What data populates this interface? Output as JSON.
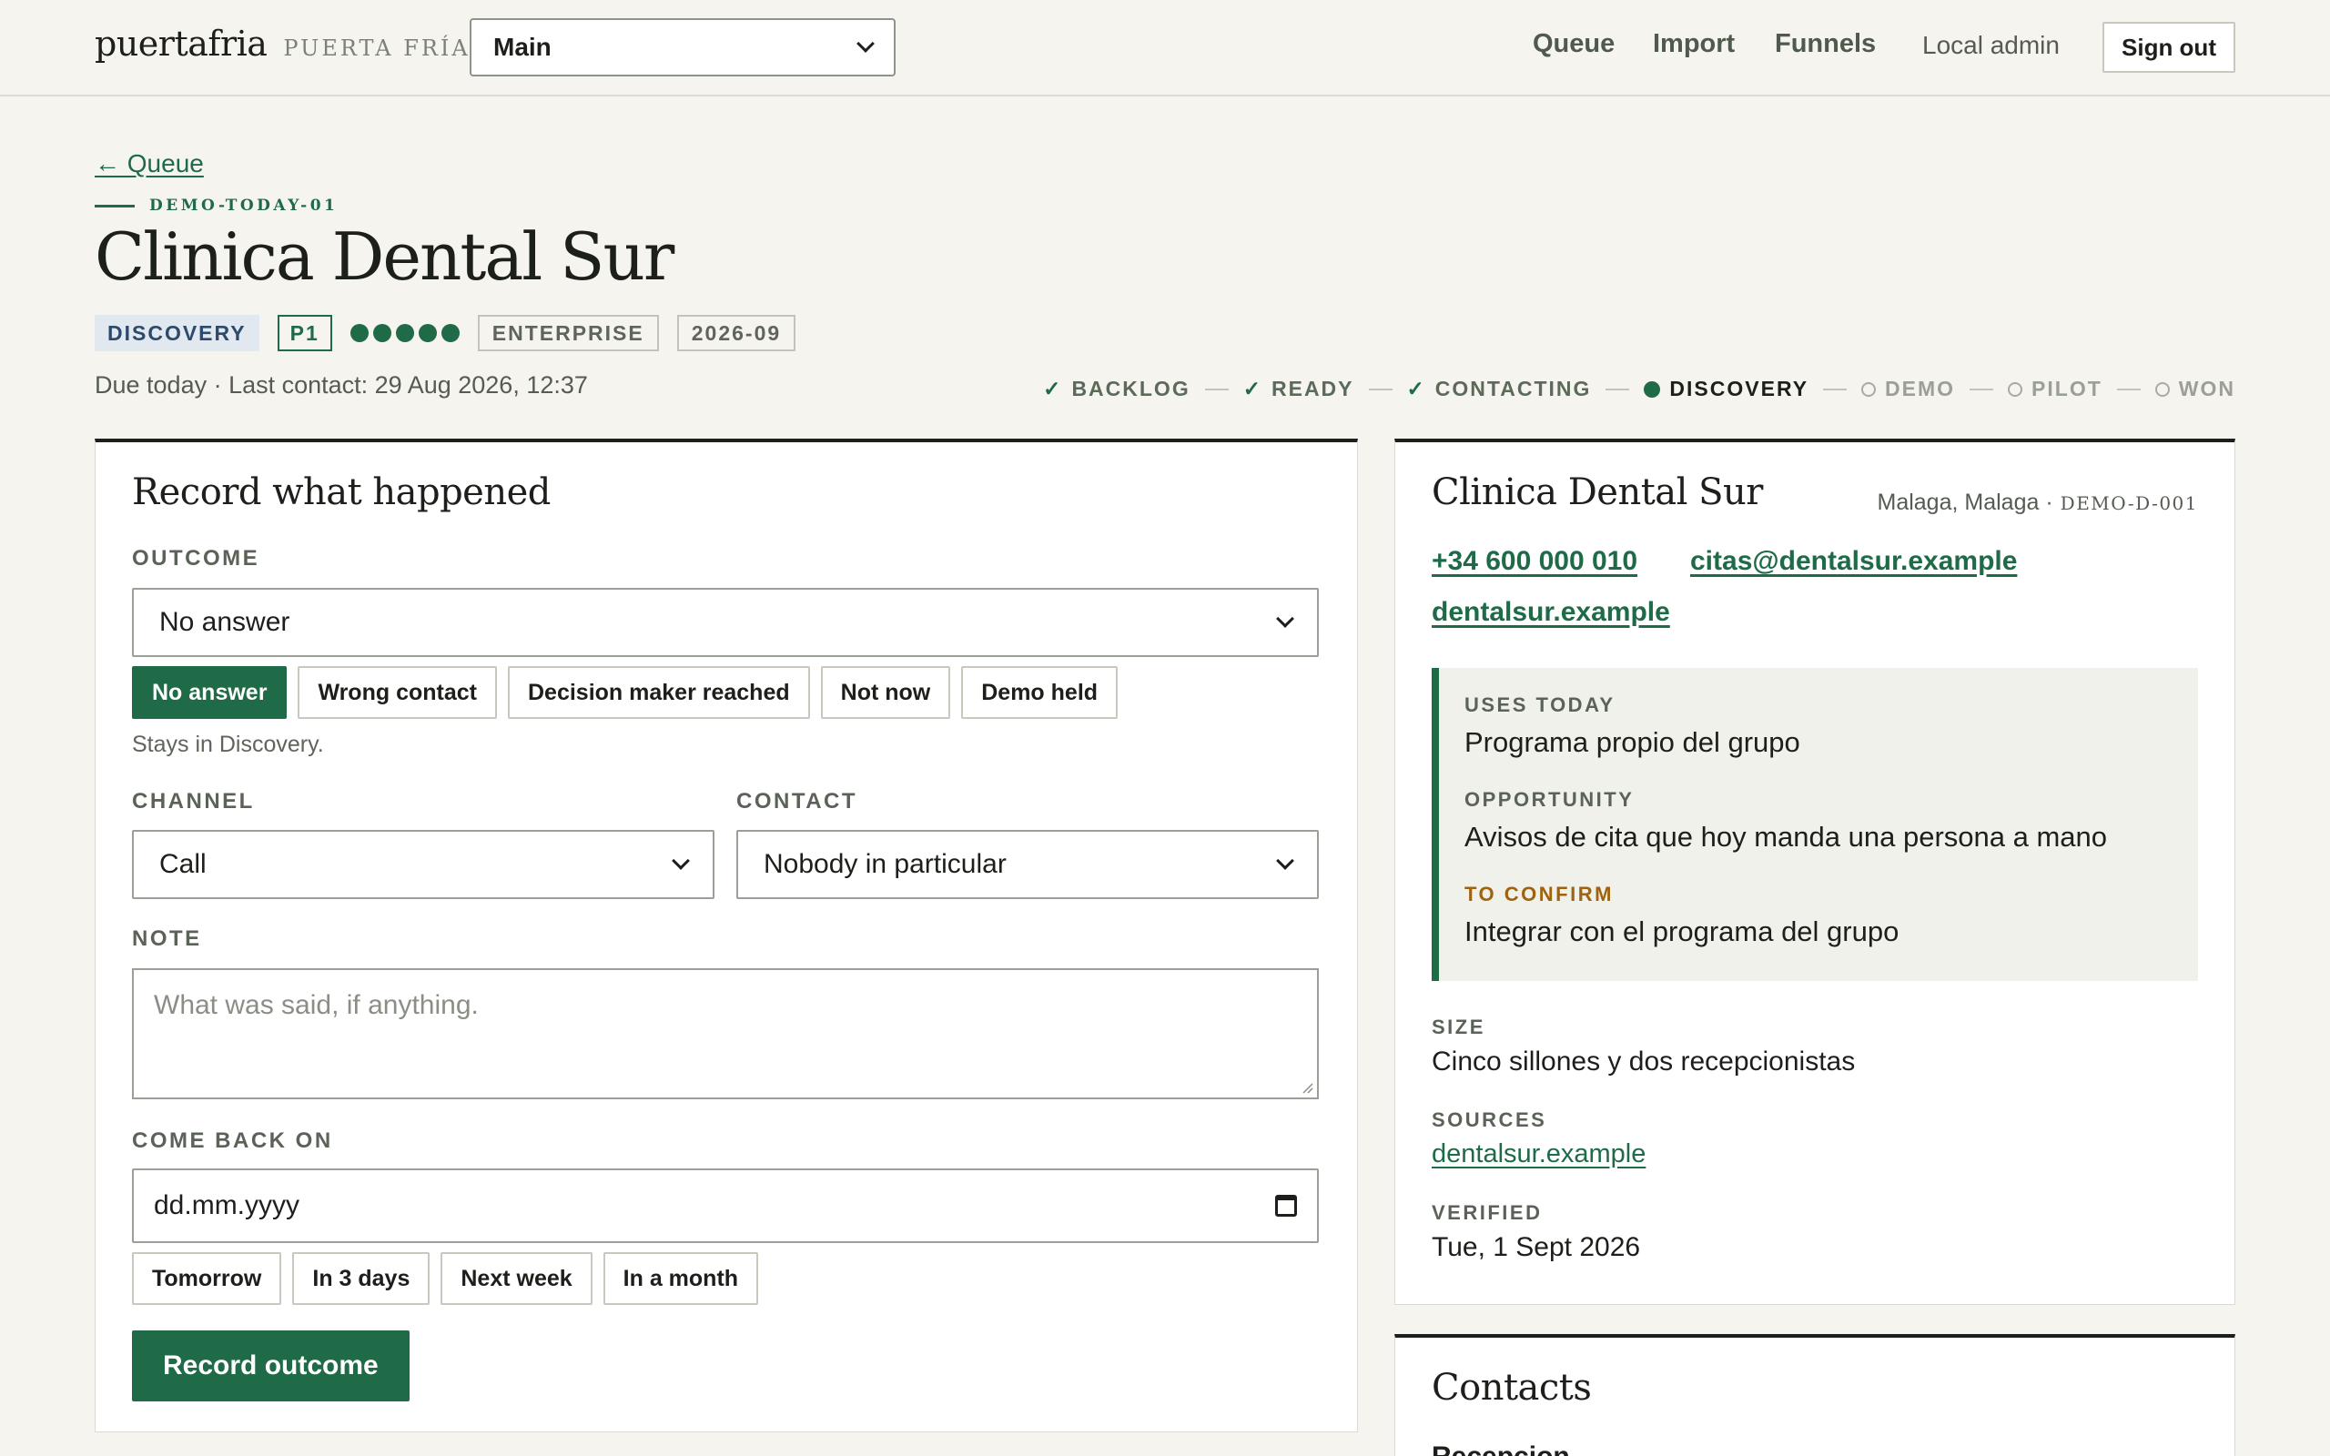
{
  "header": {
    "brand": "puertafria",
    "brand_sub": "PUERTA FRÍA",
    "workspace": "Main",
    "nav": [
      "Queue",
      "Import",
      "Funnels"
    ],
    "user": "Local admin",
    "sign_out": "Sign out"
  },
  "lead": {
    "back": "← Queue",
    "code": "DEMO-TODAY-01",
    "title": "Clinica Dental Sur",
    "stage_badge": "DISCOVERY",
    "priority": "P1",
    "rating": 5,
    "segment": "ENTERPRISE",
    "cohort": "2026-09",
    "due": "Due today · Last contact: 29 Aug 2026, 12:37"
  },
  "pipeline": [
    {
      "label": "BACKLOG",
      "state": "done"
    },
    {
      "label": "READY",
      "state": "done"
    },
    {
      "label": "CONTACTING",
      "state": "done"
    },
    {
      "label": "DISCOVERY",
      "state": "current"
    },
    {
      "label": "DEMO",
      "state": "todo"
    },
    {
      "label": "PILOT",
      "state": "todo"
    },
    {
      "label": "WON",
      "state": "todo"
    }
  ],
  "record": {
    "heading": "Record what happened",
    "outcome_label": "OUTCOME",
    "outcome_value": "No answer",
    "outcome_chips": [
      "No answer",
      "Wrong contact",
      "Decision maker reached",
      "Not now",
      "Demo held"
    ],
    "outcome_hint": "Stays in Discovery.",
    "channel_label": "CHANNEL",
    "channel_value": "Call",
    "contact_label": "CONTACT",
    "contact_value": "Nobody in particular",
    "note_label": "NOTE",
    "note_placeholder": "What was said, if anything.",
    "comeback_label": "COME BACK ON",
    "comeback_placeholder": "dd.mm.yyyy",
    "date_chips": [
      "Tomorrow",
      "In 3 days",
      "Next week",
      "In a month"
    ],
    "submit": "Record outcome"
  },
  "company": {
    "name": "Clinica Dental Sur",
    "location": "Malaga, Malaga ·",
    "id": "DEMO-D-001",
    "phone": "+34 600 000 010",
    "email": "citas@dentalsur.example",
    "website": "dentalsur.example",
    "uses_today_label": "USES TODAY",
    "uses_today": "Programa propio del grupo",
    "opportunity_label": "OPPORTUNITY",
    "opportunity": "Avisos de cita que hoy manda una persona a mano",
    "to_confirm_label": "TO CONFIRM",
    "to_confirm": "Integrar con el programa del grupo",
    "size_label": "SIZE",
    "size": "Cinco sillones y dos recepcionistas",
    "sources_label": "SOURCES",
    "sources": "dentalsur.example",
    "verified_label": "VERIFIED",
    "verified": "Tue, 1 Sept 2026"
  },
  "contacts": {
    "heading": "Contacts",
    "first": "Recepcion"
  }
}
